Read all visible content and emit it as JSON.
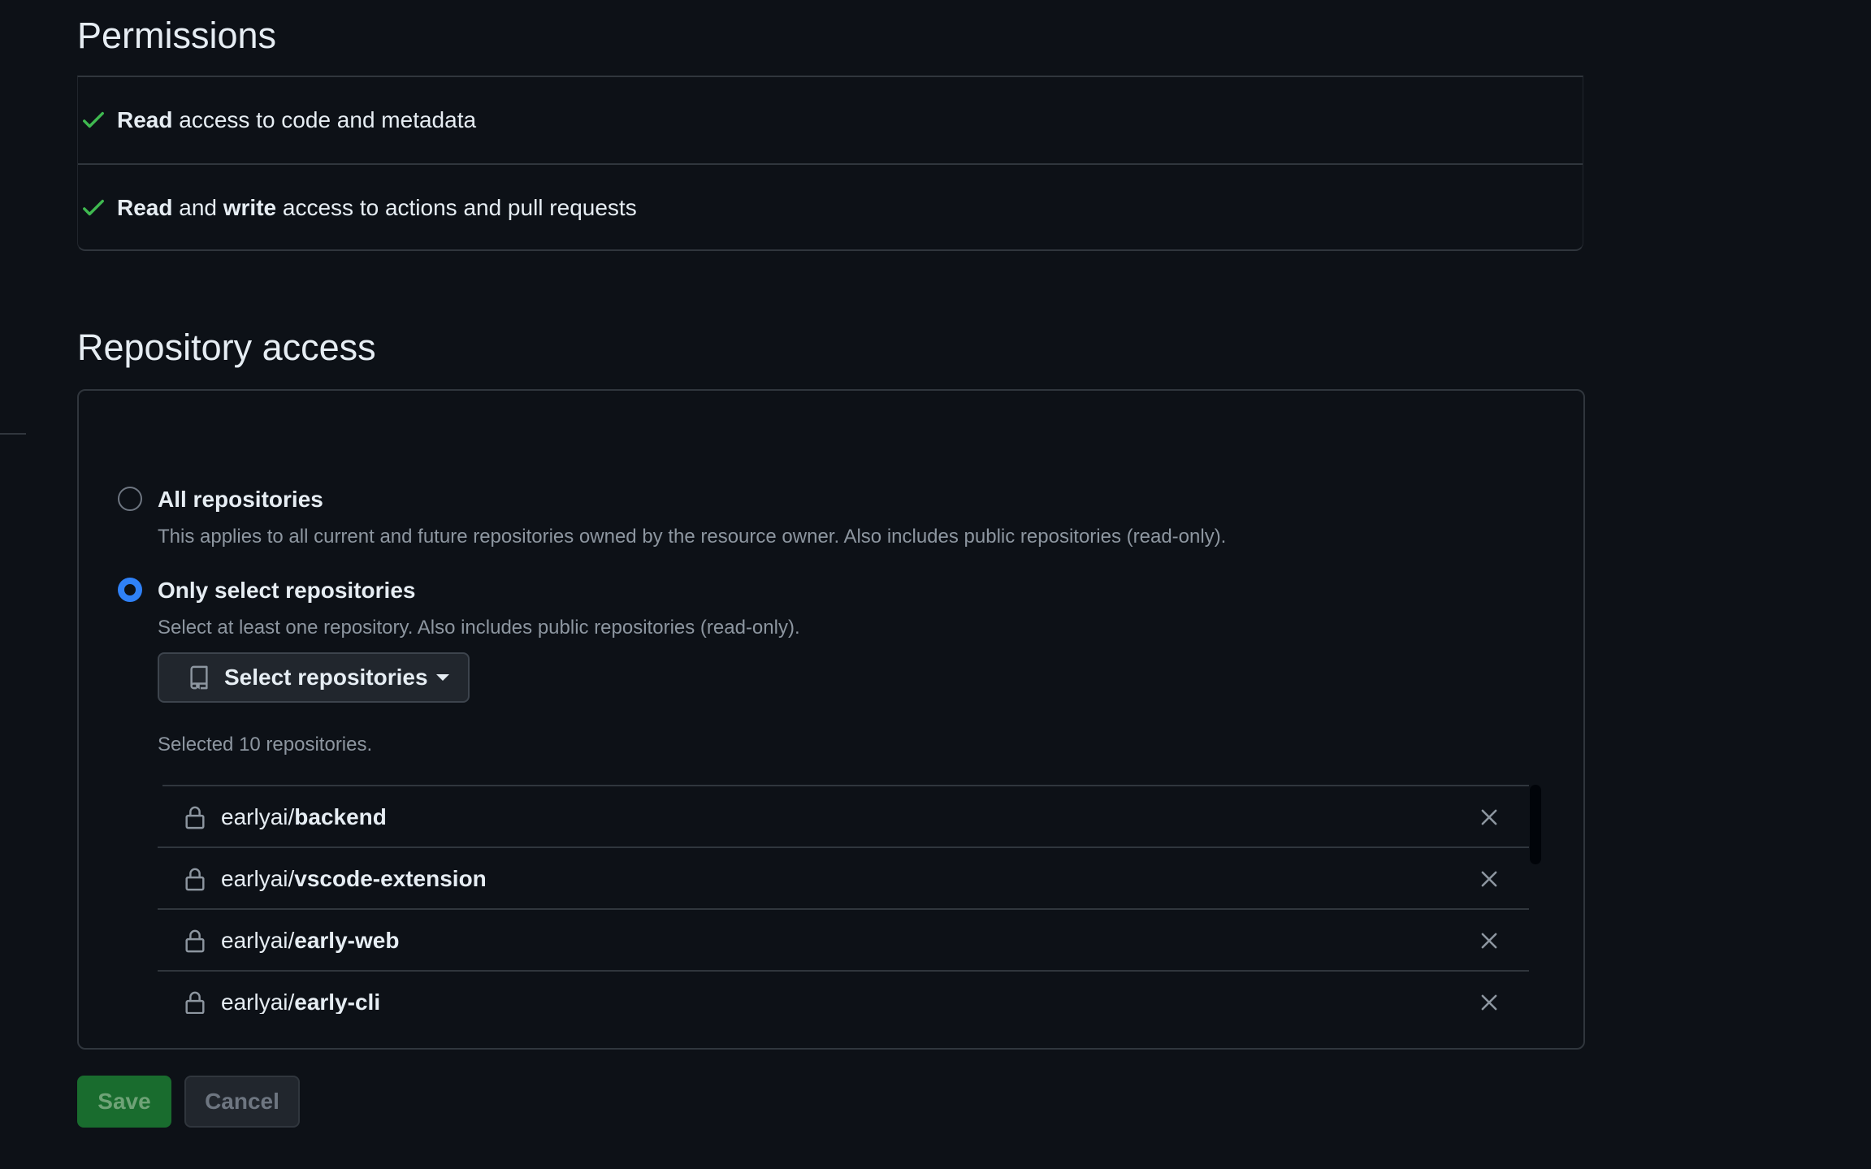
{
  "permissions": {
    "title": "Permissions",
    "items": [
      {
        "parts": [
          {
            "text": "Read",
            "bold": true
          },
          {
            "text": " access to code and metadata",
            "bold": false
          }
        ]
      },
      {
        "parts": [
          {
            "text": "Read",
            "bold": true
          },
          {
            "text": " and ",
            "bold": false
          },
          {
            "text": "write",
            "bold": true
          },
          {
            "text": " access to actions and pull requests",
            "bold": false
          }
        ]
      }
    ]
  },
  "repository_access": {
    "title": "Repository access",
    "options": [
      {
        "label": "All repositories",
        "description": "This applies to all current and future repositories owned by the resource owner. Also includes public repositories (read-only).",
        "selected": false
      },
      {
        "label": "Only select repositories",
        "description": "Select at least one repository. Also includes public repositories (read-only).",
        "selected": true
      }
    ],
    "select_button_label": "Select repositories",
    "selected_count_text": "Selected 10 repositories.",
    "repos": [
      {
        "org": "earlyai/",
        "name": "backend"
      },
      {
        "org": "earlyai/",
        "name": "vscode-extension"
      },
      {
        "org": "earlyai/",
        "name": "early-web"
      },
      {
        "org": "earlyai/",
        "name": "early-cli"
      }
    ]
  },
  "actions": {
    "save_label": "Save",
    "cancel_label": "Cancel"
  },
  "colors": {
    "background": "#0d1117",
    "check_green": "#3fb950",
    "radio_blue": "#2f81f7",
    "save_bg": "#196c2e"
  }
}
